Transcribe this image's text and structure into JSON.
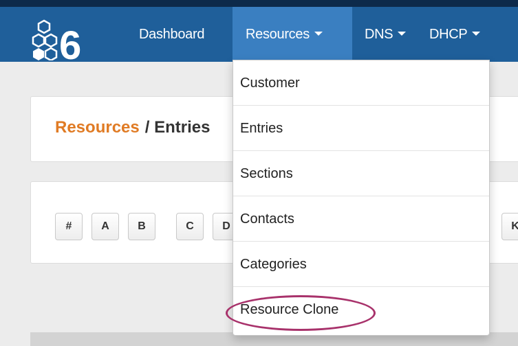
{
  "navbar": {
    "logo_text": "6",
    "items": [
      {
        "label": "Dashboard",
        "has_caret": false
      },
      {
        "label": "Resources",
        "has_caret": true,
        "active": true
      },
      {
        "label": "DNS",
        "has_caret": true
      },
      {
        "label": "DHCP",
        "has_caret": true
      }
    ]
  },
  "breadcrumb": {
    "link": "Resources",
    "current": "/ Entries"
  },
  "letter_filter": {
    "visible_buttons": [
      "#",
      "A",
      "B",
      "C",
      "D",
      "K"
    ]
  },
  "resources_menu": {
    "items": [
      "Customer",
      "Entries",
      "Sections",
      "Contacts",
      "Categories",
      "Resource Clone"
    ],
    "highlighted": "Resource Clone"
  },
  "colors": {
    "navbar": "#1f5f9a",
    "nav_active": "#3a7fc1",
    "breadcrumb_link": "#e07b24",
    "highlight_ellipse": "#a8326b"
  }
}
